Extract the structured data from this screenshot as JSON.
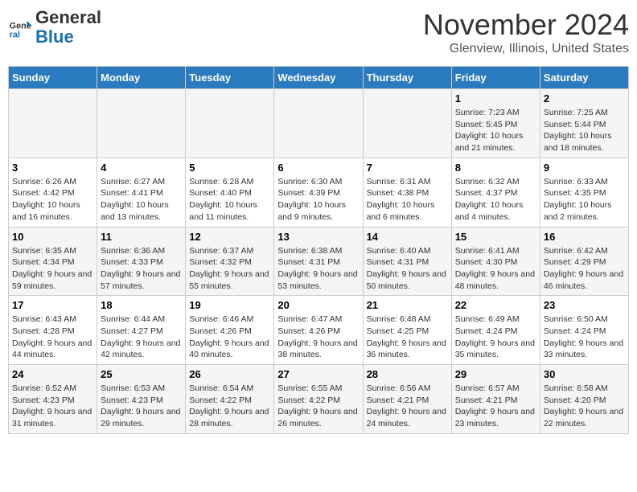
{
  "header": {
    "logo_line1": "General",
    "logo_line2": "Blue",
    "month_title": "November 2024",
    "location": "Glenview, Illinois, United States"
  },
  "weekdays": [
    "Sunday",
    "Monday",
    "Tuesday",
    "Wednesday",
    "Thursday",
    "Friday",
    "Saturday"
  ],
  "weeks": [
    [
      {
        "day": "",
        "info": ""
      },
      {
        "day": "",
        "info": ""
      },
      {
        "day": "",
        "info": ""
      },
      {
        "day": "",
        "info": ""
      },
      {
        "day": "",
        "info": ""
      },
      {
        "day": "1",
        "info": "Sunrise: 7:23 AM\nSunset: 5:45 PM\nDaylight: 10 hours and 21 minutes."
      },
      {
        "day": "2",
        "info": "Sunrise: 7:25 AM\nSunset: 5:44 PM\nDaylight: 10 hours and 18 minutes."
      }
    ],
    [
      {
        "day": "3",
        "info": "Sunrise: 6:26 AM\nSunset: 4:42 PM\nDaylight: 10 hours and 16 minutes."
      },
      {
        "day": "4",
        "info": "Sunrise: 6:27 AM\nSunset: 4:41 PM\nDaylight: 10 hours and 13 minutes."
      },
      {
        "day": "5",
        "info": "Sunrise: 6:28 AM\nSunset: 4:40 PM\nDaylight: 10 hours and 11 minutes."
      },
      {
        "day": "6",
        "info": "Sunrise: 6:30 AM\nSunset: 4:39 PM\nDaylight: 10 hours and 9 minutes."
      },
      {
        "day": "7",
        "info": "Sunrise: 6:31 AM\nSunset: 4:38 PM\nDaylight: 10 hours and 6 minutes."
      },
      {
        "day": "8",
        "info": "Sunrise: 6:32 AM\nSunset: 4:37 PM\nDaylight: 10 hours and 4 minutes."
      },
      {
        "day": "9",
        "info": "Sunrise: 6:33 AM\nSunset: 4:35 PM\nDaylight: 10 hours and 2 minutes."
      }
    ],
    [
      {
        "day": "10",
        "info": "Sunrise: 6:35 AM\nSunset: 4:34 PM\nDaylight: 9 hours and 59 minutes."
      },
      {
        "day": "11",
        "info": "Sunrise: 6:36 AM\nSunset: 4:33 PM\nDaylight: 9 hours and 57 minutes."
      },
      {
        "day": "12",
        "info": "Sunrise: 6:37 AM\nSunset: 4:32 PM\nDaylight: 9 hours and 55 minutes."
      },
      {
        "day": "13",
        "info": "Sunrise: 6:38 AM\nSunset: 4:31 PM\nDaylight: 9 hours and 53 minutes."
      },
      {
        "day": "14",
        "info": "Sunrise: 6:40 AM\nSunset: 4:31 PM\nDaylight: 9 hours and 50 minutes."
      },
      {
        "day": "15",
        "info": "Sunrise: 6:41 AM\nSunset: 4:30 PM\nDaylight: 9 hours and 48 minutes."
      },
      {
        "day": "16",
        "info": "Sunrise: 6:42 AM\nSunset: 4:29 PM\nDaylight: 9 hours and 46 minutes."
      }
    ],
    [
      {
        "day": "17",
        "info": "Sunrise: 6:43 AM\nSunset: 4:28 PM\nDaylight: 9 hours and 44 minutes."
      },
      {
        "day": "18",
        "info": "Sunrise: 6:44 AM\nSunset: 4:27 PM\nDaylight: 9 hours and 42 minutes."
      },
      {
        "day": "19",
        "info": "Sunrise: 6:46 AM\nSunset: 4:26 PM\nDaylight: 9 hours and 40 minutes."
      },
      {
        "day": "20",
        "info": "Sunrise: 6:47 AM\nSunset: 4:26 PM\nDaylight: 9 hours and 38 minutes."
      },
      {
        "day": "21",
        "info": "Sunrise: 6:48 AM\nSunset: 4:25 PM\nDaylight: 9 hours and 36 minutes."
      },
      {
        "day": "22",
        "info": "Sunrise: 6:49 AM\nSunset: 4:24 PM\nDaylight: 9 hours and 35 minutes."
      },
      {
        "day": "23",
        "info": "Sunrise: 6:50 AM\nSunset: 4:24 PM\nDaylight: 9 hours and 33 minutes."
      }
    ],
    [
      {
        "day": "24",
        "info": "Sunrise: 6:52 AM\nSunset: 4:23 PM\nDaylight: 9 hours and 31 minutes."
      },
      {
        "day": "25",
        "info": "Sunrise: 6:53 AM\nSunset: 4:23 PM\nDaylight: 9 hours and 29 minutes."
      },
      {
        "day": "26",
        "info": "Sunrise: 6:54 AM\nSunset: 4:22 PM\nDaylight: 9 hours and 28 minutes."
      },
      {
        "day": "27",
        "info": "Sunrise: 6:55 AM\nSunset: 4:22 PM\nDaylight: 9 hours and 26 minutes."
      },
      {
        "day": "28",
        "info": "Sunrise: 6:56 AM\nSunset: 4:21 PM\nDaylight: 9 hours and 24 minutes."
      },
      {
        "day": "29",
        "info": "Sunrise: 6:57 AM\nSunset: 4:21 PM\nDaylight: 9 hours and 23 minutes."
      },
      {
        "day": "30",
        "info": "Sunrise: 6:58 AM\nSunset: 4:20 PM\nDaylight: 9 hours and 22 minutes."
      }
    ]
  ]
}
